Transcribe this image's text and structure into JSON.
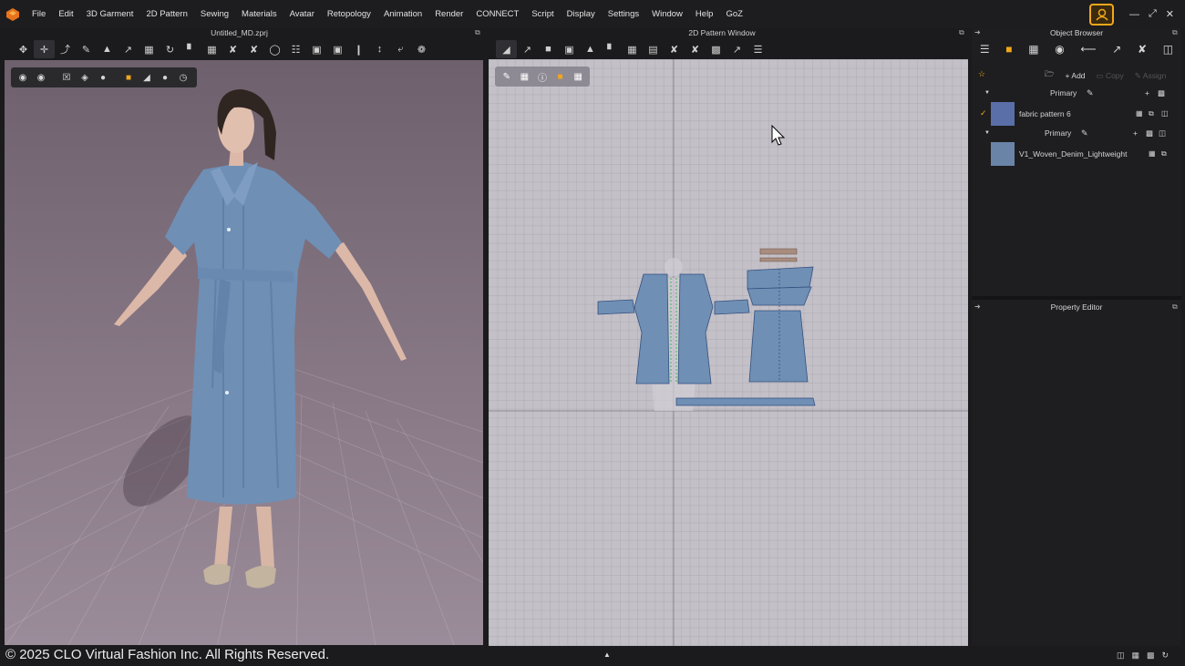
{
  "menubar": {
    "items": [
      "File",
      "Edit",
      "3D Garment",
      "2D Pattern",
      "Sewing",
      "Materials",
      "Avatar",
      "Retopology",
      "Animation",
      "Render",
      "CONNECT",
      "Script",
      "Display",
      "Settings",
      "Window",
      "Help",
      "GoZ"
    ]
  },
  "panels": {
    "view3d_title": "Untitled_MD.zprj",
    "view2d_title": "2D Pattern Window",
    "object_browser_title": "Object Browser",
    "property_editor_title": "Property Editor"
  },
  "object_browser": {
    "add_label": "Add",
    "copy_label": "Copy",
    "assign_label": "Assign",
    "groups": [
      {
        "label": "Primary",
        "item": "fabric pattern 6",
        "swatch_color": "#5a6fa8"
      },
      {
        "label": "Primary",
        "item": "V1_Woven_Denim_Lightweight",
        "swatch_color": "#6a84a8"
      }
    ]
  },
  "footer": {
    "copyright": "© 2025 CLO Virtual Fashion Inc. All Rights Reserved."
  },
  "colors": {
    "accent": "#f2a71b",
    "fabric": "#6f8fb5",
    "pattern_bg": "#c4c0c8",
    "view3d_bg": "#7c6c7a"
  },
  "icons": [
    "clo-logo-icon",
    "minimize-icon",
    "maximize-icon",
    "close-icon",
    "user-badge-icon",
    "expand-icon",
    "pin-icon",
    "add-icon",
    "folder-icon",
    "pencil-icon",
    "trash-icon",
    "checkmark-icon"
  ]
}
